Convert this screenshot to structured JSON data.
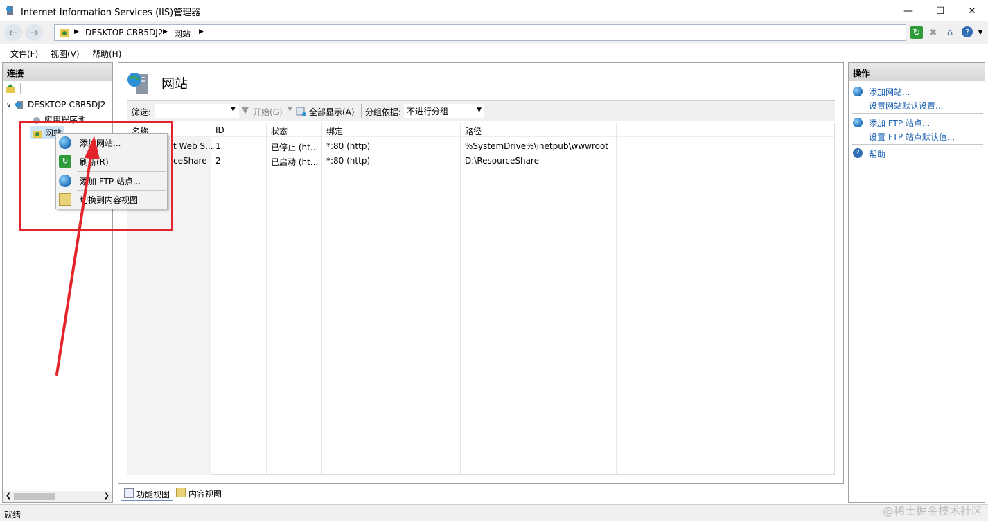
{
  "window": {
    "title": "Internet Information Services (IIS)管理器"
  },
  "address": {
    "segments": [
      "DESKTOP-CBR5DJ2",
      "网站"
    ]
  },
  "menubar": {
    "items": [
      "文件(F)",
      "视图(V)",
      "帮助(H)"
    ]
  },
  "connections": {
    "header": "连接",
    "tree": {
      "server": "DESKTOP-CBR5DJ2",
      "app_pools": "应用程序池",
      "sites": "网站"
    }
  },
  "center": {
    "title": "网站",
    "filter": {
      "label": "筛选:",
      "start": "开始(G)",
      "show_all": "全部显示(A)",
      "group_label": "分组依据:",
      "group_value": "不进行分组"
    },
    "table": {
      "columns": [
        "名称",
        "ID",
        "状态",
        "绑定",
        "路径"
      ],
      "rows": [
        {
          "name": "t Web S...",
          "id": "1",
          "status": "已停止 (ht...",
          "binding": "*:80 (http)",
          "path": "%SystemDrive%\\inetpub\\wwwroot"
        },
        {
          "name": "ceShare",
          "id": "2",
          "status": "已启动 (ht...",
          "binding": "*:80 (http)",
          "path": "D:\\ResourceShare"
        }
      ]
    },
    "view_tabs": [
      "功能视图",
      "内容视图"
    ]
  },
  "context_menu": {
    "items": [
      "添加网站...",
      "刷新(R)",
      "添加 FTP 站点...",
      "切换到内容视图"
    ]
  },
  "actions": {
    "header": "操作",
    "add_site": "添加网站...",
    "site_defaults": "设置网站默认设置...",
    "add_ftp": "添加 FTP 站点...",
    "ftp_defaults": "设置 FTP 站点默认值...",
    "help": "帮助"
  },
  "status": {
    "text": "就绪"
  },
  "watermark": "@稀土掘金技术社区",
  "colors": {
    "highlight": "#e3242b",
    "link": "#1a5fb4"
  }
}
